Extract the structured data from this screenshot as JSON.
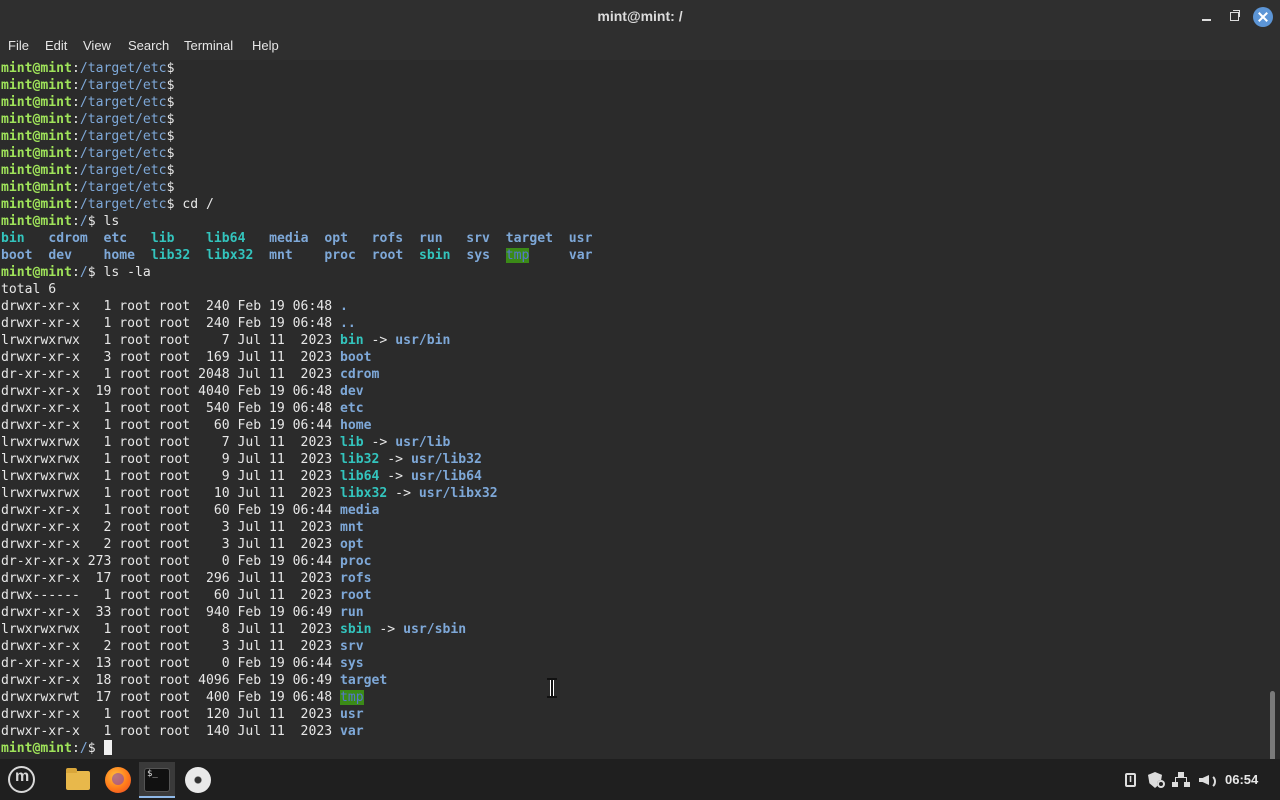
{
  "window": {
    "title": "mint@mint: /"
  },
  "menu": {
    "file": "File",
    "edit": "Edit",
    "view": "View",
    "search": "Search",
    "terminal": "Terminal",
    "help": "Help"
  },
  "terminal": {
    "lines": [
      [
        {
          "t": "mint@mint",
          "c": "p"
        },
        {
          "t": ":"
        },
        {
          "t": "/target/etc",
          "c": "pa"
        },
        {
          "t": "$ "
        }
      ],
      [
        {
          "t": "mint@mint",
          "c": "p"
        },
        {
          "t": ":"
        },
        {
          "t": "/target/etc",
          "c": "pa"
        },
        {
          "t": "$ "
        }
      ],
      [
        {
          "t": "mint@mint",
          "c": "p"
        },
        {
          "t": ":"
        },
        {
          "t": "/target/etc",
          "c": "pa"
        },
        {
          "t": "$ "
        }
      ],
      [
        {
          "t": "mint@mint",
          "c": "p"
        },
        {
          "t": ":"
        },
        {
          "t": "/target/etc",
          "c": "pa"
        },
        {
          "t": "$ "
        }
      ],
      [
        {
          "t": "mint@mint",
          "c": "p"
        },
        {
          "t": ":"
        },
        {
          "t": "/target/etc",
          "c": "pa"
        },
        {
          "t": "$ "
        }
      ],
      [
        {
          "t": "mint@mint",
          "c": "p"
        },
        {
          "t": ":"
        },
        {
          "t": "/target/etc",
          "c": "pa"
        },
        {
          "t": "$ "
        }
      ],
      [
        {
          "t": "mint@mint",
          "c": "p"
        },
        {
          "t": ":"
        },
        {
          "t": "/target/etc",
          "c": "pa"
        },
        {
          "t": "$ "
        }
      ],
      [
        {
          "t": "mint@mint",
          "c": "p"
        },
        {
          "t": ":"
        },
        {
          "t": "/target/etc",
          "c": "pa"
        },
        {
          "t": "$ "
        }
      ],
      [
        {
          "t": "mint@mint",
          "c": "p"
        },
        {
          "t": ":"
        },
        {
          "t": "/target/etc",
          "c": "pa"
        },
        {
          "t": "$ cd /"
        }
      ],
      [
        {
          "t": "mint@mint",
          "c": "p"
        },
        {
          "t": ":"
        },
        {
          "t": "/",
          "c": "pa"
        },
        {
          "t": "$ ls"
        }
      ],
      [
        {
          "t": "bin",
          "c": "l"
        },
        {
          "t": "   "
        },
        {
          "t": "cdrom",
          "c": "d"
        },
        {
          "t": "  "
        },
        {
          "t": "etc",
          "c": "d"
        },
        {
          "t": "   "
        },
        {
          "t": "lib",
          "c": "l"
        },
        {
          "t": "    "
        },
        {
          "t": "lib64",
          "c": "l"
        },
        {
          "t": "   "
        },
        {
          "t": "media",
          "c": "d"
        },
        {
          "t": "  "
        },
        {
          "t": "opt",
          "c": "d"
        },
        {
          "t": "   "
        },
        {
          "t": "rofs",
          "c": "d"
        },
        {
          "t": "  "
        },
        {
          "t": "run",
          "c": "d"
        },
        {
          "t": "   "
        },
        {
          "t": "srv",
          "c": "d"
        },
        {
          "t": "  "
        },
        {
          "t": "target",
          "c": "d"
        },
        {
          "t": "  "
        },
        {
          "t": "usr",
          "c": "d"
        }
      ],
      [
        {
          "t": "boot",
          "c": "d"
        },
        {
          "t": "  "
        },
        {
          "t": "dev",
          "c": "d"
        },
        {
          "t": "    "
        },
        {
          "t": "home",
          "c": "d"
        },
        {
          "t": "  "
        },
        {
          "t": "lib32",
          "c": "l"
        },
        {
          "t": "  "
        },
        {
          "t": "libx32",
          "c": "l"
        },
        {
          "t": "  "
        },
        {
          "t": "mnt",
          "c": "d"
        },
        {
          "t": "    "
        },
        {
          "t": "proc",
          "c": "d"
        },
        {
          "t": "  "
        },
        {
          "t": "root",
          "c": "d"
        },
        {
          "t": "  "
        },
        {
          "t": "sbin",
          "c": "l"
        },
        {
          "t": "  "
        },
        {
          "t": "sys",
          "c": "d"
        },
        {
          "t": "  "
        },
        {
          "t": "tmp",
          "c": "t"
        },
        {
          "t": "     "
        },
        {
          "t": "var",
          "c": "d"
        }
      ],
      [
        {
          "t": "mint@mint",
          "c": "p"
        },
        {
          "t": ":"
        },
        {
          "t": "/",
          "c": "pa"
        },
        {
          "t": "$ ls -la"
        }
      ],
      [
        {
          "t": "total 6"
        }
      ],
      [
        {
          "t": "drwxr-xr-x   1 root root  240 Feb 19 06:48 "
        },
        {
          "t": ".",
          "c": "d"
        }
      ],
      [
        {
          "t": "drwxr-xr-x   1 root root  240 Feb 19 06:48 "
        },
        {
          "t": "..",
          "c": "d"
        }
      ],
      [
        {
          "t": "lrwxrwxrwx   1 root root    7 Jul 11  2023 "
        },
        {
          "t": "bin",
          "c": "l"
        },
        {
          "t": " -> "
        },
        {
          "t": "usr/bin",
          "c": "d"
        }
      ],
      [
        {
          "t": "drwxr-xr-x   3 root root  169 Jul 11  2023 "
        },
        {
          "t": "boot",
          "c": "d"
        }
      ],
      [
        {
          "t": "dr-xr-xr-x   1 root root 2048 Jul 11  2023 "
        },
        {
          "t": "cdrom",
          "c": "d"
        }
      ],
      [
        {
          "t": "drwxr-xr-x  19 root root 4040 Feb 19 06:48 "
        },
        {
          "t": "dev",
          "c": "d"
        }
      ],
      [
        {
          "t": "drwxr-xr-x   1 root root  540 Feb 19 06:48 "
        },
        {
          "t": "etc",
          "c": "d"
        }
      ],
      [
        {
          "t": "drwxr-xr-x   1 root root   60 Feb 19 06:44 "
        },
        {
          "t": "home",
          "c": "d"
        }
      ],
      [
        {
          "t": "lrwxrwxrwx   1 root root    7 Jul 11  2023 "
        },
        {
          "t": "lib",
          "c": "l"
        },
        {
          "t": " -> "
        },
        {
          "t": "usr/lib",
          "c": "d"
        }
      ],
      [
        {
          "t": "lrwxrwxrwx   1 root root    9 Jul 11  2023 "
        },
        {
          "t": "lib32",
          "c": "l"
        },
        {
          "t": " -> "
        },
        {
          "t": "usr/lib32",
          "c": "d"
        }
      ],
      [
        {
          "t": "lrwxrwxrwx   1 root root    9 Jul 11  2023 "
        },
        {
          "t": "lib64",
          "c": "l"
        },
        {
          "t": " -> "
        },
        {
          "t": "usr/lib64",
          "c": "d"
        }
      ],
      [
        {
          "t": "lrwxrwxrwx   1 root root   10 Jul 11  2023 "
        },
        {
          "t": "libx32",
          "c": "l"
        },
        {
          "t": " -> "
        },
        {
          "t": "usr/libx32",
          "c": "d"
        }
      ],
      [
        {
          "t": "drwxr-xr-x   1 root root   60 Feb 19 06:44 "
        },
        {
          "t": "media",
          "c": "d"
        }
      ],
      [
        {
          "t": "drwxr-xr-x   2 root root    3 Jul 11  2023 "
        },
        {
          "t": "mnt",
          "c": "d"
        }
      ],
      [
        {
          "t": "drwxr-xr-x   2 root root    3 Jul 11  2023 "
        },
        {
          "t": "opt",
          "c": "d"
        }
      ],
      [
        {
          "t": "dr-xr-xr-x 273 root root    0 Feb 19 06:44 "
        },
        {
          "t": "proc",
          "c": "d"
        }
      ],
      [
        {
          "t": "drwxr-xr-x  17 root root  296 Jul 11  2023 "
        },
        {
          "t": "rofs",
          "c": "d"
        }
      ],
      [
        {
          "t": "drwx------   1 root root   60 Jul 11  2023 "
        },
        {
          "t": "root",
          "c": "d"
        }
      ],
      [
        {
          "t": "drwxr-xr-x  33 root root  940 Feb 19 06:49 "
        },
        {
          "t": "run",
          "c": "d"
        }
      ],
      [
        {
          "t": "lrwxrwxrwx   1 root root    8 Jul 11  2023 "
        },
        {
          "t": "sbin",
          "c": "l"
        },
        {
          "t": " -> "
        },
        {
          "t": "usr/sbin",
          "c": "d"
        }
      ],
      [
        {
          "t": "drwxr-xr-x   2 root root    3 Jul 11  2023 "
        },
        {
          "t": "srv",
          "c": "d"
        }
      ],
      [
        {
          "t": "dr-xr-xr-x  13 root root    0 Feb 19 06:44 "
        },
        {
          "t": "sys",
          "c": "d"
        }
      ],
      [
        {
          "t": "drwxr-xr-x  18 root root 4096 Feb 19 06:49 "
        },
        {
          "t": "target",
          "c": "d"
        }
      ],
      [
        {
          "t": "drwxrwxrwt  17 root root  400 Feb 19 06:48 "
        },
        {
          "t": "tmp",
          "c": "t"
        }
      ],
      [
        {
          "t": "drwxr-xr-x   1 root root  120 Jul 11  2023 "
        },
        {
          "t": "usr",
          "c": "d"
        }
      ],
      [
        {
          "t": "drwxr-xr-x   1 root root  140 Jul 11  2023 "
        },
        {
          "t": "var",
          "c": "d"
        }
      ],
      [
        {
          "t": "mint@mint",
          "c": "p"
        },
        {
          "t": ":"
        },
        {
          "t": "/",
          "c": "pa"
        },
        {
          "t": "$ "
        },
        {
          "t": "",
          "c": "cursor"
        }
      ]
    ]
  },
  "taskbar": {
    "launchers": [
      "menu-icon",
      "files-icon",
      "firefox-icon",
      "terminal-icon",
      "disc-icon"
    ],
    "tray_icons": [
      "clipboard-icon",
      "shield-icon",
      "network-icon",
      "volume-icon"
    ],
    "clock": "06:54"
  },
  "colors": {
    "prompt_user": "#9fe35a",
    "path": "#7ea8d8",
    "symlink": "#33c4bd",
    "sticky_dir_bg": "#3b8a17",
    "background": "#2b2b2b"
  }
}
